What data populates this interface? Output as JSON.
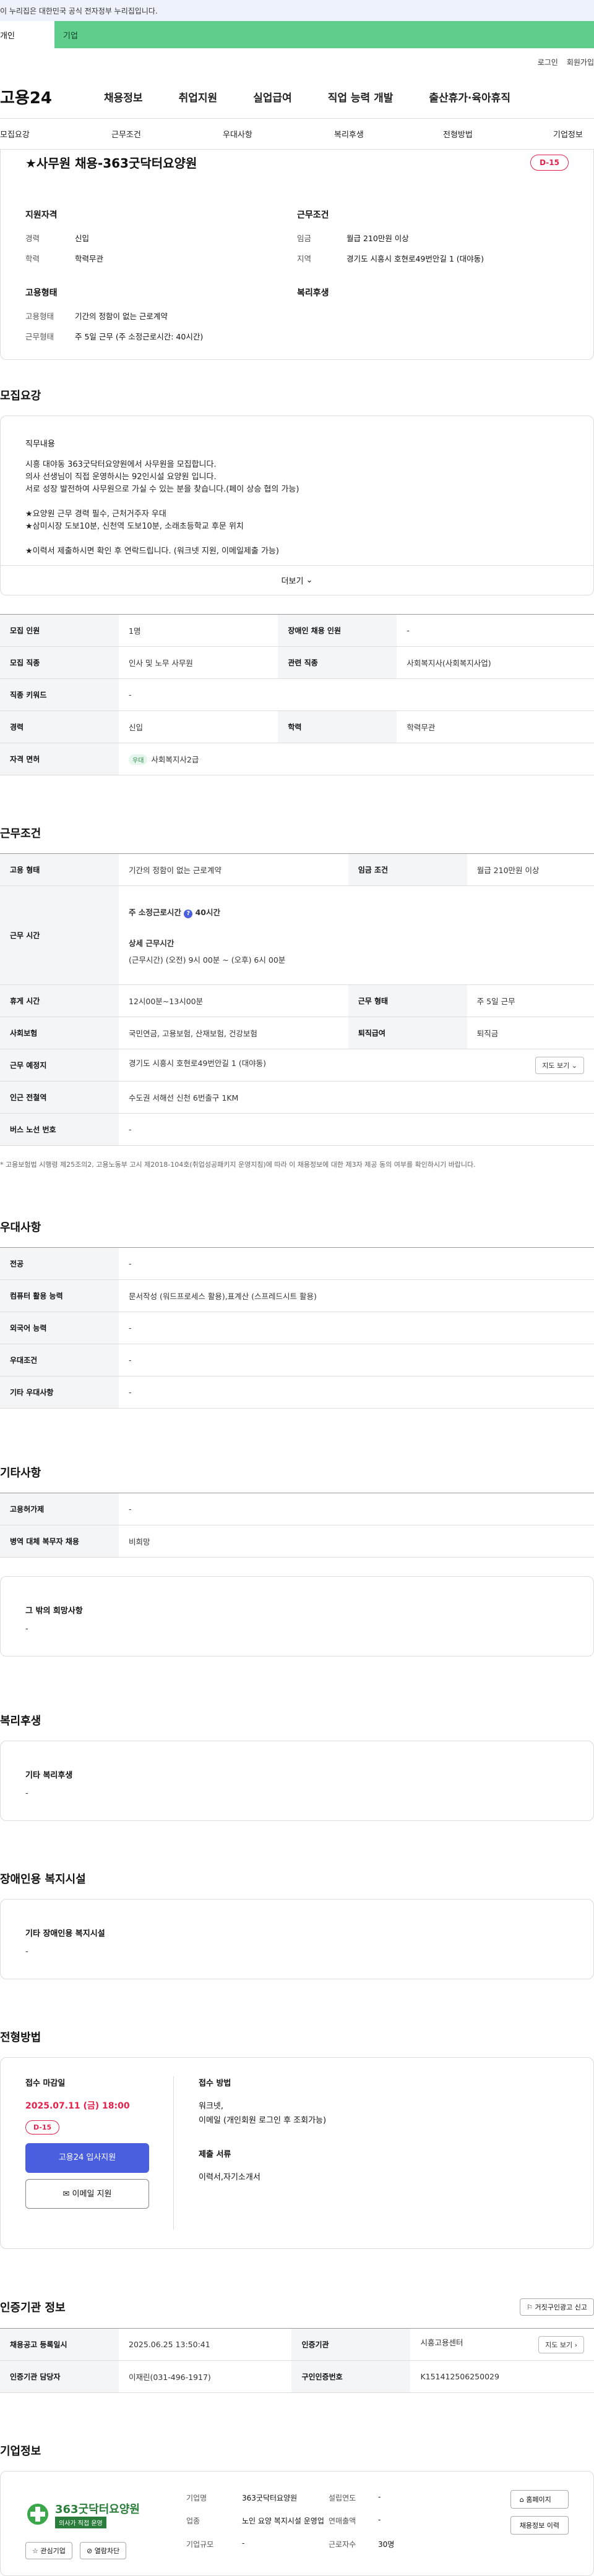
{
  "gov_banner": "이 누리집은 대한민국 공식 전자정부 누리집입니다.",
  "site_tabs": [
    "개인",
    "기업"
  ],
  "util_links": [
    "로그인",
    "회원가입"
  ],
  "logo": "고용24",
  "gnb": [
    "채용정보",
    "취업지원",
    "실업급여",
    "직업 능력 개발",
    "출산휴가·육아휴직"
  ],
  "subnav": [
    "모집요강",
    "근무조건",
    "우대사항",
    "복리후생",
    "전형방법",
    "기업정보"
  ],
  "summary": {
    "title": "★사무원 채용-363굿닥터요양원",
    "dday": "D-15",
    "qual_h": "지원자격",
    "qual": [
      {
        "k": "경력",
        "v": "신입"
      },
      {
        "k": "학력",
        "v": "학력무관"
      }
    ],
    "work_h": "근무조건",
    "work": [
      {
        "k": "임금",
        "v": "월급 210만원 이상"
      },
      {
        "k": "지역",
        "v": "경기도 시흥시 호현로49번안길 1 (대야동)"
      }
    ],
    "emp_h": "고용형태",
    "emp": [
      {
        "k": "고용형태",
        "v": "기간의 정함이 없는 근로계약"
      },
      {
        "k": "근무형태",
        "v": "주 5일 근무 (주 소정근로시간: 40시간)"
      }
    ],
    "welfare_h": "복리후생"
  },
  "recruit": {
    "title": "모집요강",
    "desc_label": "직무내용",
    "desc_lines": [
      "시흥 대야동 363굿닥터요양원에서 사무원을 모집합니다.",
      "의사 선생님이 직접 운영하시는 92인시설 요양원 입니다.",
      "서로 성장 발전하여 사무원으로 가실 수 있는 분을 찾습니다.(페이 상승 협의 가능)",
      "",
      "★요양원 근무 경력 필수, 근처거주자 우대",
      "★삼미시장 도보10분, 신천역 도보10분, 소래초등학교 후문 위치",
      "",
      "★이력서 제출하시면 확인 후 연락드립니다. (워크넷 지원, 이메일제출 가능)"
    ],
    "more": "더보기",
    "rows": [
      {
        "k1": "모집 인원",
        "v1": "1명",
        "k2": "장애인 채용 인원",
        "v2": "-"
      },
      {
        "k1": "모집 직종",
        "v1": "인사 및 노무 사무원",
        "k2": "관련 직종",
        "v2": "사회복지사(사회복지사업)"
      },
      {
        "k1": "직종 키워드",
        "v1": "-"
      },
      {
        "k1": "경력",
        "v1": "신입",
        "k2": "학력",
        "v2": "학력무관"
      },
      {
        "k1": "자격 면허",
        "badge": "우대",
        "v1": "사회복지사2급"
      }
    ]
  },
  "conditions": {
    "title": "근무조건",
    "employ_k": "고용 형태",
    "employ_v": "기간의 정함이 없는 근로계약",
    "wage_k": "임금 조건",
    "wage_v": "월급 210만원 이상",
    "hours_k": "근무 시간",
    "hours_sub1": "주 소정근로시간",
    "hours_sub1_v": "40시간",
    "hours_sub2": "상세 근무시간",
    "hours_sub2_v": "(근무시간) (오전) 9시 00분 ~ (오후) 6시 00분",
    "rest_k": "휴게 시간",
    "rest_v": "12시00분~13시00분",
    "shift_k": "근무 형태",
    "shift_v": "주 5일 근무",
    "ins_k": "사회보험",
    "ins_v": "국민연금, 고용보험, 산재보험, 건강보험",
    "sev_k": "퇴직급여",
    "sev_v": "퇴직금",
    "place_k": "근무 예정지",
    "place_v": "경기도 시흥시 호현로49번안길 1 (대야동)",
    "map_btn": "지도 보기",
    "station_k": "인근 전철역",
    "station_v": "수도권 서해선 신천 6번출구 1KM",
    "bus_k": "버스 노선 번호",
    "bus_v": "-",
    "note": "* 고용보험법 시행령 제25조의2, 고용노동부 고시 제2018-104호(취업성공패키지 운영지침)에 따라 이 채용정보에 대한 제3자 제공 동의 여부를 확인하시기 바랍니다."
  },
  "prefer": {
    "title": "우대사항",
    "rows": [
      {
        "k": "전공",
        "v": "-"
      },
      {
        "k": "컴퓨터 활용 능력",
        "v": "문서작성 (워드프로세스 활용),표계산 (스프레드시트 활용)"
      },
      {
        "k": "외국어 능력",
        "v": "-"
      },
      {
        "k": "우대조건",
        "v": "-"
      },
      {
        "k": "기타 우대사항",
        "v": "-"
      }
    ]
  },
  "etc": {
    "title": "기타사항",
    "rows": [
      {
        "k": "고용허가제",
        "v": "-"
      },
      {
        "k": "병역 대체 복무자 채용",
        "v": "비희망"
      }
    ],
    "other_k": "그 밖의 희망사항",
    "other_v": "-"
  },
  "welfare": {
    "title": "복리후생",
    "k": "기타 복리후생",
    "v": "-"
  },
  "disabled": {
    "title": "장애인용 복지시설",
    "k": "기타 장애인용 복지시설",
    "v": "-"
  },
  "process": {
    "title": "전형방법",
    "deadline_k": "접수 마감일",
    "deadline_v": "2025.07.11 (금) 18:00",
    "dday": "D-15",
    "apply_btn": "고용24 입사지원",
    "email_btn": "이메일 지원",
    "method_k": "접수 방법",
    "method_v1": "워크넷,",
    "method_v2": "이메일 (개인회원 로그인 후 조회가능)",
    "docs_k": "제출 서류",
    "docs_v": "이력서,자기소개서"
  },
  "cert": {
    "title": "인증기관 정보",
    "report_btn": "거짓구인광고 신고",
    "r1k1": "채용공고 등록일시",
    "r1v1": "2025.06.25 13:50:41",
    "r1k2": "인증기관",
    "r1v2": "시흥고용센터",
    "map_btn": "지도 보기",
    "r2k1": "인증기관 담당자",
    "r2v1": "이재린(031-496-1917)",
    "r2k2": "구인인증번호",
    "r2v2": "K151412506250029"
  },
  "company": {
    "title": "기업정보",
    "logo_text": "363굿닥터요양원",
    "logo_sub": "의사가 직접 운영",
    "fav_btn": "관심기업",
    "block_btn": "열람차단",
    "name_k": "기업명",
    "name_v": "363굿닥터요양원",
    "ind_k": "업종",
    "ind_v": "노인 요양 복지시설 운영업",
    "size_k": "기업규모",
    "size_v": "-",
    "est_k": "설립연도",
    "est_v": "-",
    "sales_k": "연매출액",
    "sales_v": "-",
    "emp_k": "근로자수",
    "emp_v": "30명",
    "home_btn": "홈페이지",
    "list_btn": "채용정보 이력"
  },
  "colors": {
    "accent": "#4a5fe0",
    "dday": "#e3214b",
    "green_tab": "#5fce8c"
  }
}
